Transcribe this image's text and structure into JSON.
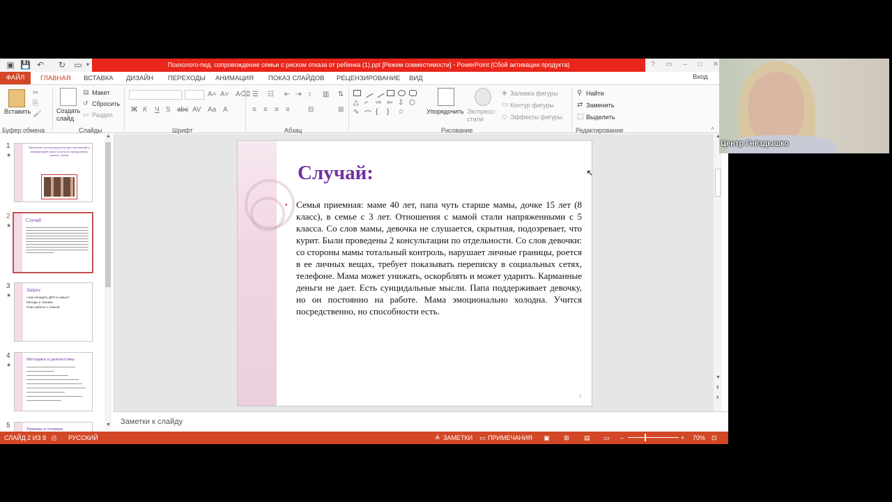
{
  "window": {
    "title": "Психолого-пед. сопровождение семьи с риском отказа от ребенка (1).ppt [Режим совместимости] -  PowerPoint (Сбой активации продукта)",
    "signin": "Вход"
  },
  "tabs": {
    "file": "ФАЙЛ",
    "home": "ГЛАВНАЯ",
    "insert": "ВСТАВКА",
    "design": "ДИЗАЙН",
    "transitions": "ПЕРЕХОДЫ",
    "animations": "АНИМАЦИЯ",
    "slideshow": "ПОКАЗ СЛАЙДОВ",
    "review": "РЕЦЕНЗИРОВАНИЕ",
    "view": "ВИД"
  },
  "ribbon": {
    "paste": "Вставить",
    "clipboard": "Буфер обмена",
    "new_slide": "Создать слайд",
    "layout": "Макет",
    "reset": "Сбросить",
    "section": "Раздел",
    "slides": "Слайды",
    "font": "Шрифт",
    "paragraph": "Абзац",
    "arrange": "Упорядочить",
    "quick_styles": "Экспресс-стили",
    "shape_fill": "Заливка фигуры",
    "shape_outline": "Контур фигуры",
    "shape_effects": "Эффекты фигуры",
    "drawing": "Рисование",
    "find": "Найти",
    "replace": "Заменить",
    "select": "Выделить",
    "editing": "Редактирование"
  },
  "thumbnails": [
    {
      "num": "1",
      "title": "Проблемы детско-родительских отношений в замещающей семье и пути их преодоления: анализ случая"
    },
    {
      "num": "2",
      "title": "Случай"
    },
    {
      "num": "3",
      "title": "Запрос",
      "lines": [
        "• Как наладить ДРО в семье?",
        "Методы и техники",
        "План работы с семьей"
      ]
    },
    {
      "num": "4",
      "title": "Методики и диагностика"
    },
    {
      "num": "5",
      "title": "Приемы и техники"
    }
  ],
  "slide": {
    "title": "Случай:",
    "bullet": "•",
    "body": "Семья приемная: маме 40 лет, папа чуть старше мамы, дочке 15 лет (8 класс), в семье с 3 лет. Отношения с мамой стали напряженными с 5 класса. Со слов мамы, девочка не слушается, скрытная, подозревает, что курит. Были проведены 2 консультации по отдельности. Со слов девочки: со стороны мамы тотальный контроль, нарушает личные границы, роется в ее личных вещах, требует показывать переписку в социальных сетях, телефоне. Мама может унижать, оскорблять и может ударить. Карманные деньги не дает. Есть суицидальные мысли. Папа поддерживает девочку, но он постоянно на работе. Мама эмоционально холодна. Учится посредственно, но способности есть.",
    "page_number": "2"
  },
  "notes": {
    "placeholder": "Заметки к слайду"
  },
  "status": {
    "slide_info": "СЛАЙД 2 ИЗ 8",
    "language": "РУССКИЙ",
    "notes_btn": "ЗАМЕТКИ",
    "comments_btn": "ПРИМЕЧАНИЯ",
    "zoom": "70%"
  },
  "webcam": {
    "name": "Центр Гнёздышко"
  },
  "colors": {
    "accent": "#d24726",
    "title_red": "#e8261b",
    "slide_title": "#7030a0"
  }
}
